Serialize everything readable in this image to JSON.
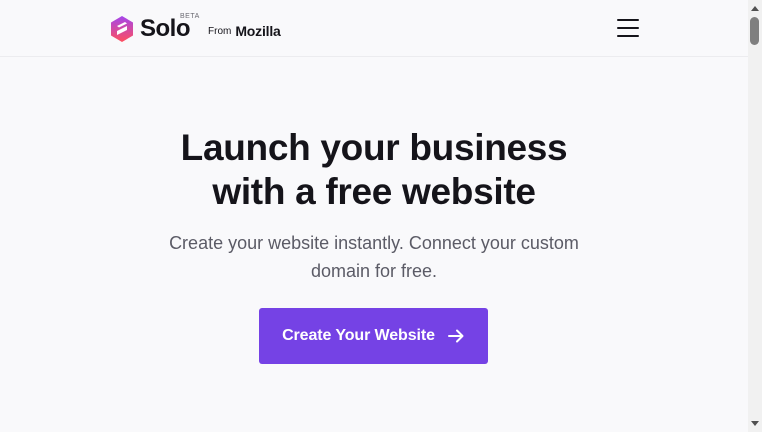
{
  "header": {
    "brand_name": "Solo",
    "beta_label": "BETA",
    "from_label": "From",
    "mozilla_label": "Mozilla",
    "menu_icon": "hamburger-menu-icon"
  },
  "hero": {
    "title_line1": "Launch your business",
    "title_line2": "with a free website",
    "subtitle_line1": "Create your website instantly. Connect your custom",
    "subtitle_line2": "domain for free.",
    "cta_label": "Create Your Website",
    "cta_icon": "arrow-right-icon"
  },
  "colors": {
    "accent": "#7542e5",
    "text": "#15141a",
    "muted": "#5b5b66",
    "background": "#f9f9fb",
    "logo_top": "#a445ed",
    "logo_bottom": "#ff4f5e"
  }
}
